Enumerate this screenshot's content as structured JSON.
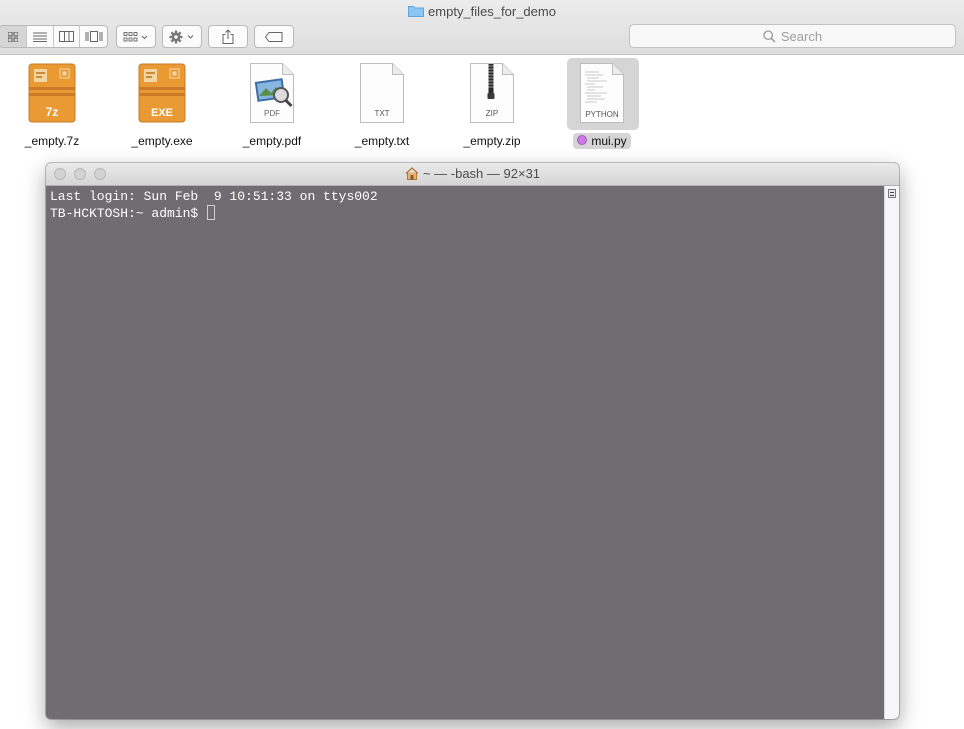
{
  "finder": {
    "title": "empty_files_for_demo",
    "search_placeholder": "Search",
    "files": [
      {
        "name": "_empty.7z",
        "badge": "7z",
        "kind": "archive-7z-icon"
      },
      {
        "name": "_empty.exe",
        "badge": "EXE",
        "kind": "exe-icon"
      },
      {
        "name": "_empty.pdf",
        "badge": "PDF",
        "kind": "pdf-icon"
      },
      {
        "name": "_empty.txt",
        "badge": "TXT",
        "kind": "txt-icon"
      },
      {
        "name": "_empty.zip",
        "badge": "ZIP",
        "kind": "zip-icon"
      },
      {
        "name": "mui.py",
        "badge": "PYTHON",
        "kind": "python-file-icon",
        "selected": true,
        "tag_color": "#c77ae0"
      }
    ]
  },
  "terminal": {
    "title": "~ — -bash — 92×31",
    "lines": [
      "Last login: Sun Feb  9 10:51:33 on ttys002",
      "TB-HCKTOSH:~ admin$ "
    ]
  },
  "colors": {
    "archive_orange": "#e8952e",
    "terminal_bg": "#6f6d71",
    "folder_blue": "#6cb4ee"
  }
}
